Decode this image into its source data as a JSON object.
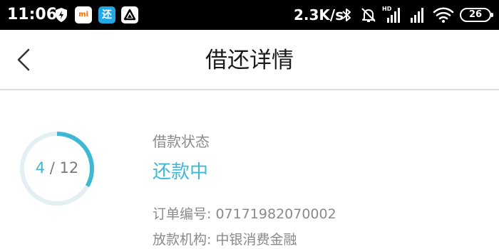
{
  "status_bar": {
    "time": "11:06",
    "mi_badge": "mi",
    "app_badge": "还",
    "net_speed": "2.3K/s",
    "hd_label": "HD",
    "battery": "26",
    "icons": [
      "shield-icon",
      "mi-app-icon",
      "huan-app-icon",
      "delta-app-icon",
      "bluetooth-icon",
      "mute-icon",
      "signal-icon",
      "signal-icon",
      "wifi-icon",
      "battery-icon"
    ]
  },
  "header": {
    "title": "借还详情",
    "back_icon": "chevron-left-icon"
  },
  "loan": {
    "progress": {
      "current": "4",
      "separator": " / ",
      "total": "12",
      "fraction": 0.333
    },
    "status_label": "借款状态",
    "status_value": "还款中",
    "order": {
      "label": "订单编号: ",
      "value": "07171982070002"
    },
    "lender": {
      "label": "放款机构: ",
      "value": "中银消费金融"
    }
  },
  "colors": {
    "accent": "#3fb8d4",
    "ring_track": "#e3eff2",
    "muted_text": "#8a8a8a",
    "status_bar_bg": "#000000"
  }
}
